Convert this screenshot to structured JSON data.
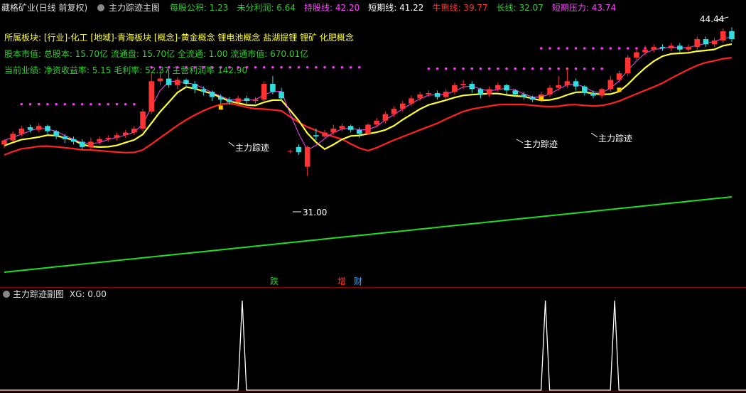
{
  "header": {
    "stock_title": "藏格矿业(日线 前复权)",
    "indicator_name": "主力踪迹主图",
    "items": [
      {
        "label": "每股公积: 1.23",
        "color": "#33cc33"
      },
      {
        "label": "未分利润: 6.64",
        "color": "#33cc33"
      },
      {
        "label": "持股线: 42.20",
        "color": "#ff44ff"
      },
      {
        "label": "短期线: 41.22",
        "color": "#ffffff"
      },
      {
        "label": "牛熊线: 39.77",
        "color": "#ff3333"
      },
      {
        "label": "长线: 32.07",
        "color": "#33cc33"
      },
      {
        "label": "短期压力: 43.74",
        "color": "#ff44ff"
      }
    ]
  },
  "info": {
    "line1": "所属板块: [行业]-化工 [地域]-青海板块 [概念]-黄金概念 锂电池概念 盐湖提锂 锂矿 化肥概念",
    "line2": "股本市值: 总股本: 15.70亿 流通盘: 15.70亿 全流通: 1.00 流通市值: 670.01亿",
    "line3": "当前业绩: 净资收益率: 5.15 毛利率: 52.37 主营利润率 142.90"
  },
  "annotations": {
    "high_label": "44.44",
    "low_label": "31.00",
    "track_label": "主力踪迹"
  },
  "event_markers": [
    {
      "label": "跌",
      "color": "#33cc33"
    },
    {
      "label": "增",
      "color": "#ff3333"
    },
    {
      "label": "财",
      "color": "#33aaff"
    }
  ],
  "sub_panel": {
    "title": "主力踪迹副图",
    "value_label": "XG: 0.00"
  },
  "colors": {
    "up": "#ff3333",
    "down": "#33dddd",
    "short_line": "#ffff33",
    "long_line": "#ff2222",
    "holding_line": "#ff44ff",
    "slow_line": "#22dd22",
    "pressure_dots": "#ff33ff"
  },
  "chart_data": {
    "type": "line",
    "price_high": 44.44,
    "price_low": 31.0,
    "xg_signal": [
      0,
      0,
      0,
      0,
      0,
      0,
      0,
      0,
      0,
      0,
      0,
      0,
      0,
      0,
      0,
      0,
      0,
      0,
      0,
      0,
      0,
      0,
      0,
      0,
      0,
      0,
      1,
      0,
      0,
      0,
      0,
      0,
      0,
      0,
      0,
      0,
      0,
      0,
      0,
      0,
      0,
      0,
      0,
      0,
      0,
      0,
      0,
      0,
      0,
      0,
      0,
      0,
      0,
      0,
      0,
      0,
      0,
      0,
      0,
      0,
      0,
      1,
      0,
      0,
      0,
      0,
      0,
      0,
      0,
      1,
      0,
      0,
      0,
      0,
      0,
      0,
      0,
      0,
      0,
      0,
      0,
      0,
      0,
      0,
      0
    ],
    "candles": [
      [
        36.0,
        36.3,
        35.7,
        36.4
      ],
      [
        36.3,
        36.8,
        36.2,
        37.0
      ],
      [
        36.8,
        37.2,
        36.6,
        37.4
      ],
      [
        37.3,
        37.1,
        36.9,
        37.5
      ],
      [
        37.1,
        37.4,
        36.9,
        37.6
      ],
      [
        37.4,
        37.0,
        36.8,
        37.5
      ],
      [
        37.0,
        36.6,
        36.4,
        37.1
      ],
      [
        36.6,
        36.4,
        36.1,
        36.8
      ],
      [
        36.4,
        36.2,
        36.0,
        36.6
      ],
      [
        36.2,
        35.8,
        35.6,
        36.4
      ],
      [
        35.8,
        36.2,
        35.6,
        36.5
      ],
      [
        36.2,
        36.4,
        36.0,
        36.6
      ],
      [
        36.4,
        36.5,
        36.2,
        36.7
      ],
      [
        36.5,
        36.7,
        36.3,
        36.9
      ],
      [
        36.7,
        36.9,
        36.5,
        37.1
      ],
      [
        36.9,
        37.2,
        36.7,
        37.4
      ],
      [
        37.2,
        38.5,
        37.0,
        38.7
      ],
      [
        38.5,
        40.8,
        38.3,
        41.5
      ],
      [
        40.8,
        41.0,
        40.5,
        41.6
      ],
      [
        41.0,
        40.5,
        40.3,
        41.7
      ],
      [
        40.5,
        40.9,
        40.2,
        41.1
      ],
      [
        40.9,
        40.6,
        40.3,
        41.0
      ],
      [
        40.6,
        40.2,
        39.9,
        40.8
      ],
      [
        40.2,
        40.0,
        39.7,
        40.4
      ],
      [
        40.0,
        39.6,
        39.3,
        40.1
      ],
      [
        39.6,
        39.4,
        39.1,
        39.8
      ],
      [
        39.4,
        39.2,
        39.0,
        39.6
      ],
      [
        39.2,
        39.5,
        39.0,
        39.7
      ],
      [
        39.5,
        39.3,
        39.1,
        39.7
      ],
      [
        39.3,
        39.4,
        39.1,
        39.6
      ],
      [
        39.4,
        40.6,
        39.2,
        40.8
      ],
      [
        40.6,
        40.0,
        39.8,
        41.2
      ],
      [
        40.0,
        39.5,
        39.3,
        40.3
      ],
      [
        35.5,
        35.5,
        35.3,
        35.6
      ],
      [
        35.8,
        35.4,
        35.2,
        36.0
      ],
      [
        34.3,
        35.8,
        33.6,
        35.9
      ],
      [
        36.7,
        36.6,
        36.3,
        37.2
      ],
      [
        36.6,
        36.9,
        36.5,
        37.1
      ],
      [
        36.9,
        37.2,
        36.7,
        37.5
      ],
      [
        37.2,
        37.4,
        37.0,
        37.6
      ],
      [
        37.4,
        37.1,
        36.9,
        37.5
      ],
      [
        37.1,
        36.8,
        36.5,
        37.3
      ],
      [
        36.8,
        37.5,
        36.7,
        37.6
      ],
      [
        37.5,
        37.8,
        37.3,
        38.0
      ],
      [
        37.8,
        38.3,
        37.6,
        38.5
      ],
      [
        38.3,
        38.7,
        38.1,
        38.9
      ],
      [
        38.7,
        39.1,
        38.5,
        39.3
      ],
      [
        39.1,
        39.5,
        38.9,
        39.7
      ],
      [
        39.5,
        39.8,
        39.3,
        40.0
      ],
      [
        39.8,
        39.9,
        39.6,
        40.1
      ],
      [
        39.9,
        39.6,
        39.4,
        40.1
      ],
      [
        39.6,
        40.0,
        39.4,
        40.2
      ],
      [
        40.0,
        40.5,
        39.8,
        40.7
      ],
      [
        40.5,
        40.6,
        40.2,
        40.9
      ],
      [
        40.6,
        40.2,
        39.9,
        40.8
      ],
      [
        40.2,
        39.8,
        39.5,
        40.3
      ],
      [
        39.8,
        40.2,
        39.6,
        40.4
      ],
      [
        40.2,
        40.5,
        40.0,
        40.7
      ],
      [
        40.5,
        40.1,
        39.8,
        40.6
      ],
      [
        40.1,
        39.8,
        39.6,
        40.2
      ],
      [
        39.8,
        39.6,
        39.4,
        40.0
      ],
      [
        39.6,
        39.4,
        39.2,
        39.7
      ],
      [
        39.4,
        39.8,
        39.2,
        40.0
      ],
      [
        39.8,
        40.3,
        39.6,
        40.5
      ],
      [
        40.3,
        40.5,
        40.1,
        41.2
      ],
      [
        40.5,
        40.8,
        40.3,
        41.8
      ],
      [
        40.8,
        40.4,
        40.1,
        41.0
      ],
      [
        40.4,
        39.9,
        39.7,
        40.5
      ],
      [
        39.9,
        39.7,
        39.5,
        40.1
      ],
      [
        39.7,
        40.2,
        39.5,
        40.3
      ],
      [
        40.2,
        40.9,
        40.0,
        41.2
      ],
      [
        40.9,
        41.4,
        40.7,
        41.6
      ],
      [
        41.4,
        42.6,
        41.2,
        42.8
      ],
      [
        42.6,
        43.0,
        42.4,
        43.3
      ],
      [
        43.0,
        43.2,
        42.8,
        43.5
      ],
      [
        43.2,
        43.4,
        43.0,
        43.6
      ],
      [
        43.4,
        43.3,
        43.1,
        43.6
      ],
      [
        43.3,
        43.5,
        43.1,
        43.7
      ],
      [
        43.5,
        43.2,
        43.0,
        43.7
      ],
      [
        43.2,
        43.4,
        43.0,
        43.6
      ],
      [
        43.4,
        44.0,
        43.2,
        44.2
      ],
      [
        44.0,
        43.6,
        43.4,
        44.2
      ],
      [
        43.6,
        43.9,
        43.4,
        44.1
      ],
      [
        43.9,
        44.6,
        43.7,
        44.8
      ],
      [
        44.6,
        44.0,
        43.8,
        44.9
      ]
    ]
  }
}
